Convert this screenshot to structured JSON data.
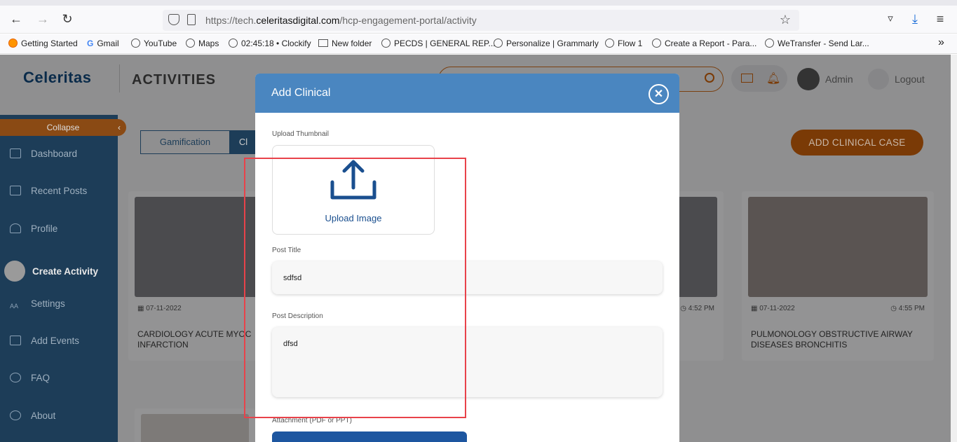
{
  "browser": {
    "url_prefix": "https://tech.",
    "url_domain": "celeritasdigital.com",
    "url_path": "/hcp-engagement-portal/activity",
    "bookmarks": [
      "Getting Started",
      "Gmail",
      "YouTube",
      "Maps",
      "02:45:18 • Clockify",
      "New folder",
      "PECDS | GENERAL REP...",
      "Personalize | Grammarly",
      "Flow 1",
      "Create a Report - Para...",
      "WeTransfer - Send Lar..."
    ]
  },
  "header": {
    "logo": "Celeritas",
    "title": "ACTIVITIES",
    "admin": "Admin",
    "logout": "Logout"
  },
  "sidebar": {
    "collapse": "Collapse",
    "items": [
      "Dashboard",
      "Recent Posts",
      "Profile",
      "Create Activity",
      "Settings",
      "Add Events",
      "FAQ",
      "About"
    ]
  },
  "content": {
    "tabs": [
      "Gamification",
      "Cl"
    ],
    "add_button": "ADD CLINICAL CASE",
    "cards": [
      {
        "date": "07-11-2022",
        "time": "",
        "title": "CARDIOLOGY ACUTE MYOC INFARCTION"
      },
      {
        "date": "",
        "time": "4:52 PM",
        "title": ""
      },
      {
        "date": "07-11-2022",
        "time": "4:55 PM",
        "title": "PULMONOLOGY OBSTRUCTIVE AIRWAY DISEASES BRONCHITIS"
      }
    ]
  },
  "modal": {
    "title": "Add Clinical",
    "thumbnail_label": "Upload Thumbnail",
    "upload_text": "Upload Image",
    "post_title_label": "Post Title",
    "post_title_value": "sdfsd",
    "post_desc_label": "Post Description",
    "post_desc_value": "dfsd",
    "attachment_label": "Attachment (PDF or PPT)"
  }
}
